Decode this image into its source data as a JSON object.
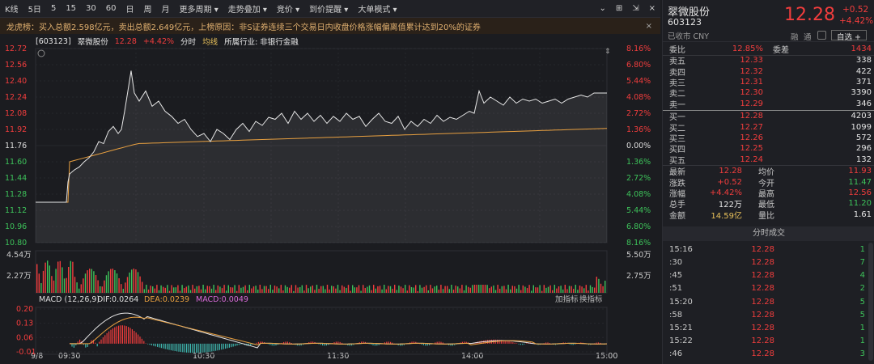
{
  "toolbar": {
    "items": [
      "K线",
      "5日",
      "5",
      "15",
      "30",
      "60",
      "日",
      "周",
      "月",
      "更多周期",
      "走势叠加",
      "竞价",
      "到价提醒",
      "大单模式"
    ],
    "icons": [
      "chevron-down-icon",
      "grid-icon",
      "expand-icon",
      "close-icon"
    ]
  },
  "notice": {
    "text": "龙虎榜：买入总额2.598亿元，卖出总额2.649亿元，上榜原因：非S证券连续三个交易日内收盘价格涨幅偏离值累计达到20%的证券",
    "close": "×"
  },
  "info": {
    "code": "[603123]",
    "name": "翠微股份",
    "price": "12.28",
    "pct": "+4.42%",
    "mode": "分时",
    "avg": "均线",
    "industry": "所属行业: 非银行金融"
  },
  "price_axis": {
    "left": [
      "12.72",
      "12.56",
      "12.40",
      "12.24",
      "12.08",
      "11.92",
      "11.76",
      "11.60",
      "11.44",
      "11.28",
      "11.12",
      "10.96",
      "10.80"
    ],
    "right": [
      "8.16%",
      "6.80%",
      "5.44%",
      "4.08%",
      "2.72%",
      "1.36%",
      "0.00%",
      "1.36%",
      "2.72%",
      "4.08%",
      "5.44%",
      "6.80%",
      "8.16%"
    ]
  },
  "volume_axis": {
    "left": [
      "4.54万",
      "2.27万"
    ],
    "right": [
      "5.50万",
      "2.75万"
    ]
  },
  "macd": {
    "label": "MACD (12,26,9)",
    "dif": "DIF:0.0264",
    "dea": "DEA:0.0239",
    "macd": "MACD:0.0049",
    "add": "加指标",
    "switch": "换指标",
    "axis": [
      "0.20",
      "0.13",
      "0.06",
      "-0.01"
    ]
  },
  "time_axis": [
    "9/8",
    "09:30",
    "10:30",
    "11:30",
    "14:00",
    "15:00"
  ],
  "stock": {
    "name": "翠微股份",
    "code": "603123",
    "status": "已收市 CNY",
    "price": "12.28",
    "change": "+0.52",
    "pct": "+4.42%",
    "tags": [
      "融",
      "通"
    ],
    "watch": "自选 +"
  },
  "orderbook": {
    "header": {
      "l1": "委比",
      "v1": "12.85%",
      "l2": "委差",
      "v2": "1434"
    },
    "asks": [
      {
        "label": "卖五",
        "price": "12.33",
        "vol": "338"
      },
      {
        "label": "卖四",
        "price": "12.32",
        "vol": "422"
      },
      {
        "label": "卖三",
        "price": "12.31",
        "vol": "371"
      },
      {
        "label": "卖二",
        "price": "12.30",
        "vol": "3390"
      },
      {
        "label": "卖一",
        "price": "12.29",
        "vol": "346"
      }
    ],
    "bids": [
      {
        "label": "买一",
        "price": "12.28",
        "vol": "4203"
      },
      {
        "label": "买二",
        "price": "12.27",
        "vol": "1099"
      },
      {
        "label": "买三",
        "price": "12.26",
        "vol": "572"
      },
      {
        "label": "买四",
        "price": "12.25",
        "vol": "296"
      },
      {
        "label": "买五",
        "price": "12.24",
        "vol": "132"
      }
    ]
  },
  "stats": [
    {
      "a": "最新",
      "b": "12.28",
      "bc": "red",
      "c": "均价",
      "d": "11.93",
      "dc": "red"
    },
    {
      "a": "涨跌",
      "b": "+0.52",
      "bc": "red",
      "c": "今开",
      "d": "11.47",
      "dc": "green"
    },
    {
      "a": "涨幅",
      "b": "+4.42%",
      "bc": "red",
      "c": "最高",
      "d": "12.56",
      "dc": "red"
    },
    {
      "a": "总手",
      "b": "122万",
      "bc": "white",
      "c": "最低",
      "d": "11.20",
      "dc": "green"
    },
    {
      "a": "金额",
      "b": "14.59亿",
      "bc": "yel",
      "c": "量比",
      "d": "1.61",
      "dc": "white"
    }
  ],
  "ticks": {
    "title": "分时成交",
    "rows": [
      {
        "t": "15:16",
        "p": "12.28",
        "v": "1",
        "vc": "green"
      },
      {
        "t": ":30",
        "p": "12.28",
        "v": "7",
        "vc": "green"
      },
      {
        "t": ":45",
        "p": "12.28",
        "v": "4",
        "vc": "green"
      },
      {
        "t": ":51",
        "p": "12.28",
        "v": "2",
        "vc": "green"
      },
      {
        "t": "15:20",
        "p": "12.28",
        "v": "5",
        "vc": "green"
      },
      {
        "t": ":58",
        "p": "12.28",
        "v": "5",
        "vc": "green"
      },
      {
        "t": "15:21",
        "p": "12.28",
        "v": "1",
        "vc": "green"
      },
      {
        "t": "15:22",
        "p": "12.28",
        "v": "1",
        "vc": "green"
      },
      {
        "t": ":46",
        "p": "12.28",
        "v": "3",
        "vc": "green"
      }
    ]
  },
  "colors": {
    "up": "#f23d3d",
    "down": "#3dc25a",
    "avg": "#e8a040",
    "price": "#e6e6e6"
  }
}
